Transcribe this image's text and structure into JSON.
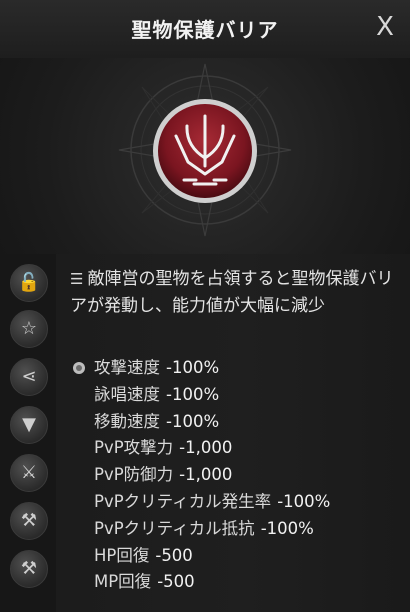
{
  "window": {
    "title": "聖物保護バリア",
    "close_label": "X"
  },
  "emblem": {
    "icon": "trident-crest-icon"
  },
  "sidebar": {
    "icons": [
      "lock-icon",
      "star-icon",
      "share-icon",
      "anvil-icon",
      "dagger-icon",
      "hammer-icon",
      "axe-icon"
    ]
  },
  "description": {
    "lead_icon": "list-icon",
    "text": "敵陣営の聖物を占領すると聖物保護バリアが発動し、能力値が大幅に減少"
  },
  "stats": [
    {
      "name": "攻撃速度",
      "value": "-100%"
    },
    {
      "name": "詠唱速度",
      "value": "-100%"
    },
    {
      "name": "移動速度",
      "value": "-100%"
    },
    {
      "name": "PvP攻撃力",
      "value": "-1,000"
    },
    {
      "name": "PvP防御力",
      "value": "-1,000"
    },
    {
      "name": "PvPクリティカル発生率",
      "value": "-100%"
    },
    {
      "name": "PvPクリティカル抵抗",
      "value": "-100%"
    },
    {
      "name": "HP回復",
      "value": "-500"
    },
    {
      "name": "MP回復",
      "value": "-500"
    }
  ],
  "colors": {
    "accent": "#8e1f2a",
    "text": "#e9e9e9",
    "panel": "#1e1e1e"
  }
}
